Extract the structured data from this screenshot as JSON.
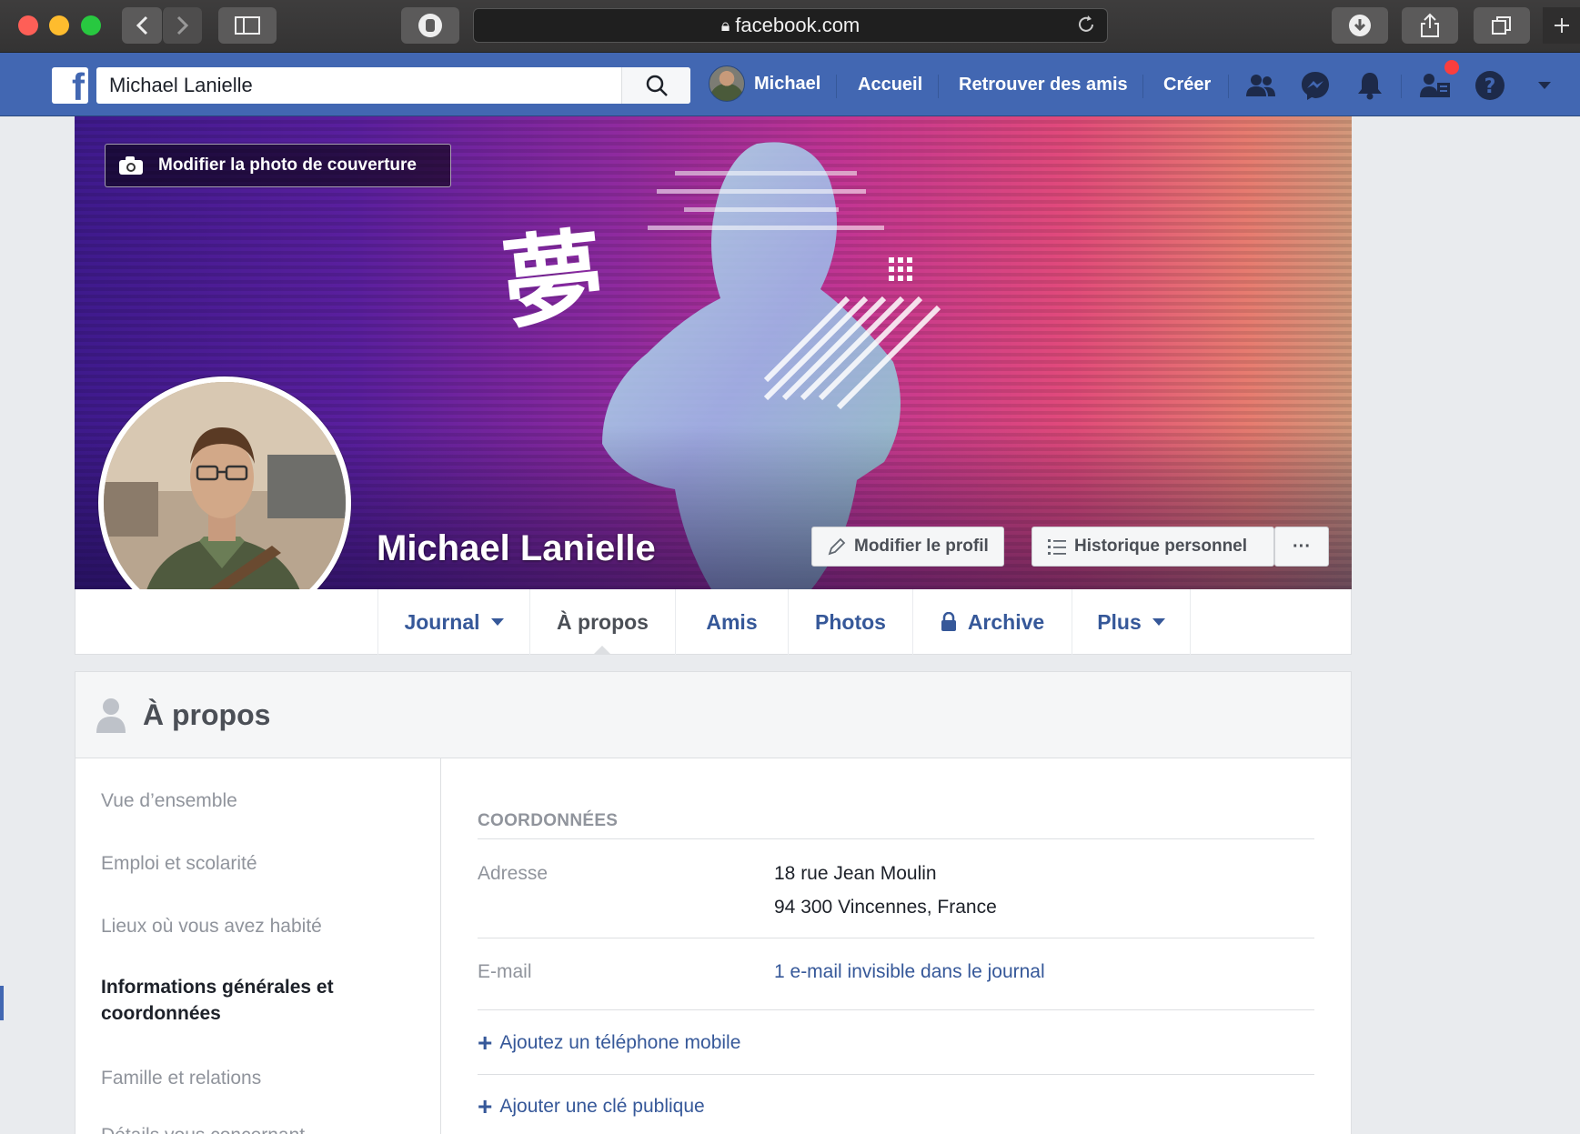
{
  "browser": {
    "url": "facebook.com",
    "icons": [
      "back-icon",
      "forward-icon",
      "sidebar-icon",
      "extension-hand-icon",
      "lock-icon",
      "reload-icon",
      "download-icon",
      "share-icon",
      "tabs-icon",
      "new-tab-icon"
    ]
  },
  "fb_header": {
    "logo": "f",
    "search_value": "Michael Lanielle",
    "user_name": "Michael",
    "nav": [
      "Accueil",
      "Retrouver des amis",
      "Créer"
    ],
    "icons": [
      "friends-icon",
      "messenger-icon",
      "notifications-icon",
      "friend-requests-icon",
      "help-icon",
      "dropdown-caret-icon"
    ],
    "colors": {
      "brand": "#4267b2",
      "notification": "#fa3e3e"
    }
  },
  "cover": {
    "edit_cover_label": "Modifier la photo de couverture",
    "kanji": "夢",
    "profile_name": "Michael Lanielle",
    "edit_profile_label": "Modifier le profil",
    "activity_log_label": "Historique personnel",
    "more_label": "···"
  },
  "tabs": [
    {
      "label": "Journal",
      "caret": true
    },
    {
      "label": "À propos",
      "active": true
    },
    {
      "label": "Amis"
    },
    {
      "label": "Photos"
    },
    {
      "label": "Archive",
      "locked": true
    },
    {
      "label": "Plus",
      "caret": true
    }
  ],
  "about": {
    "title": "À propos",
    "sidebar": [
      "Vue d’ensemble",
      "Emploi et scolarité",
      "Lieux où vous avez habité",
      "Informations générales et coordonnées",
      "Famille et relations",
      "Détails vous concernant"
    ],
    "active_index": 3,
    "section_title": "COORDONNÉES",
    "address_label": "Adresse",
    "address_line1": "18 rue Jean Moulin",
    "address_line2": "94 300 Vincennes, France",
    "email_label": "E-mail",
    "email_value": "1 e-mail invisible dans le journal",
    "add_phone": "Ajoutez un téléphone mobile",
    "add_key": "Ajouter une clé publique"
  }
}
